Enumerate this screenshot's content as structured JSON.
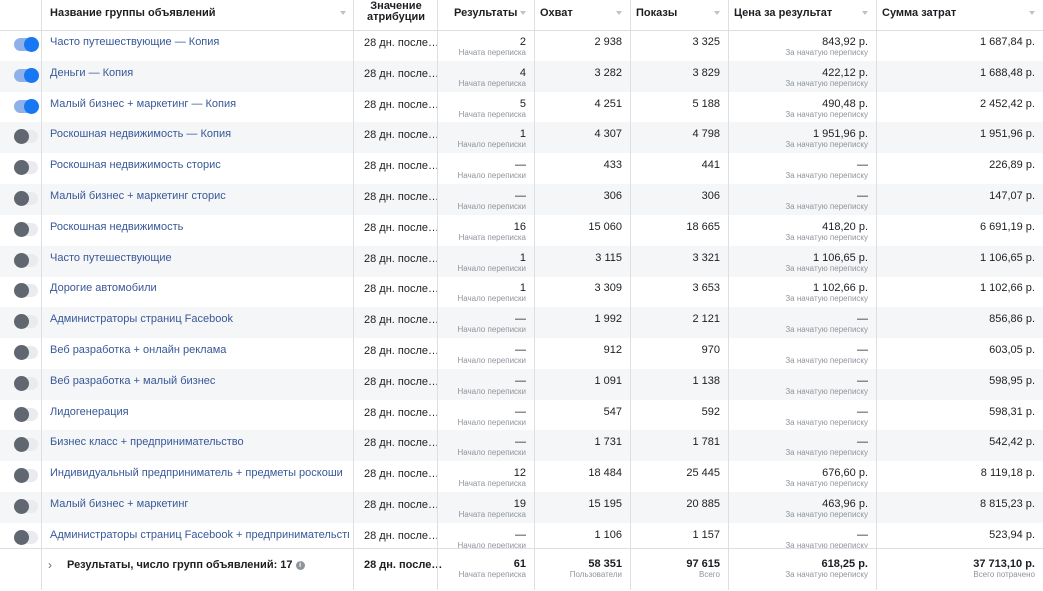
{
  "columns": {
    "name": "Название группы объявлений",
    "attribution_line1": "Значение",
    "attribution_line2": "атрибуции",
    "results": "Результаты",
    "reach": "Охват",
    "impressions": "Показы",
    "cost_per_result": "Цена за результат",
    "amount_spent": "Сумма затрат"
  },
  "rows": [
    {
      "on": true,
      "name": "Часто путешествующие — Копия",
      "attr": "28 дн. после…",
      "results": "2",
      "results_sub": "Начата переписка",
      "reach": "2 938",
      "impressions": "3 325",
      "cpr": "843,92 р.",
      "cpr_sub": "За начатую переписку",
      "spent": "1 687,84 р."
    },
    {
      "on": true,
      "name": "Деньги — Копия",
      "attr": "28 дн. после…",
      "results": "4",
      "results_sub": "Начата переписка",
      "reach": "3 282",
      "impressions": "3 829",
      "cpr": "422,12 р.",
      "cpr_sub": "За начатую переписку",
      "spent": "1 688,48 р."
    },
    {
      "on": true,
      "name": "Малый бизнес + маркетинг — Копия",
      "attr": "28 дн. после…",
      "results": "5",
      "results_sub": "Начата переписка",
      "reach": "4 251",
      "impressions": "5 188",
      "cpr": "490,48 р.",
      "cpr_sub": "За начатую переписку",
      "spent": "2 452,42 р."
    },
    {
      "on": false,
      "name": "Роскошная недвижимость — Копия",
      "attr": "28 дн. после…",
      "results": "1",
      "results_sub": "Начало переписки",
      "reach": "4 307",
      "impressions": "4 798",
      "cpr": "1 951,96 р.",
      "cpr_sub": "За начатую переписку",
      "spent": "1 951,96 р."
    },
    {
      "on": false,
      "name": "Роскошная недвижимость сторис",
      "attr": "28 дн. после…",
      "results": "—",
      "results_sub": "Начало переписки",
      "reach": "433",
      "impressions": "441",
      "cpr": "—",
      "cpr_sub": "За начатую переписку",
      "spent": "226,89 р."
    },
    {
      "on": false,
      "name": "Малый бизнес + маркетинг сторис",
      "attr": "28 дн. после…",
      "results": "—",
      "results_sub": "Начало переписки",
      "reach": "306",
      "impressions": "306",
      "cpr": "—",
      "cpr_sub": "За начатую переписку",
      "spent": "147,07 р."
    },
    {
      "on": false,
      "name": "Роскошная недвижимость",
      "attr": "28 дн. после…",
      "results": "16",
      "results_sub": "Начата переписка",
      "reach": "15 060",
      "impressions": "18 665",
      "cpr": "418,20 р.",
      "cpr_sub": "За начатую переписку",
      "spent": "6 691,19 р."
    },
    {
      "on": false,
      "name": "Часто путешествующие",
      "attr": "28 дн. после…",
      "results": "1",
      "results_sub": "Начало переписки",
      "reach": "3 115",
      "impressions": "3 321",
      "cpr": "1 106,65 р.",
      "cpr_sub": "За начатую переписку",
      "spent": "1 106,65 р."
    },
    {
      "on": false,
      "name": "Дорогие автомобили",
      "attr": "28 дн. после…",
      "results": "1",
      "results_sub": "Начало переписки",
      "reach": "3 309",
      "impressions": "3 653",
      "cpr": "1 102,66 р.",
      "cpr_sub": "За начатую переписку",
      "spent": "1 102,66 р."
    },
    {
      "on": false,
      "name": "Администраторы страниц Facebook",
      "attr": "28 дн. после…",
      "results": "—",
      "results_sub": "Начало переписки",
      "reach": "1 992",
      "impressions": "2 121",
      "cpr": "—",
      "cpr_sub": "За начатую переписку",
      "spent": "856,86 р."
    },
    {
      "on": false,
      "name": "Веб разработка + онлайн реклама",
      "attr": "28 дн. после…",
      "results": "—",
      "results_sub": "Начало переписки",
      "reach": "912",
      "impressions": "970",
      "cpr": "—",
      "cpr_sub": "За начатую переписку",
      "spent": "603,05 р."
    },
    {
      "on": false,
      "name": "Веб разработка + малый бизнес",
      "attr": "28 дн. после…",
      "results": "—",
      "results_sub": "Начало переписки",
      "reach": "1 091",
      "impressions": "1 138",
      "cpr": "—",
      "cpr_sub": "За начатую переписку",
      "spent": "598,95 р."
    },
    {
      "on": false,
      "name": "Лидогенерация",
      "attr": "28 дн. после…",
      "results": "—",
      "results_sub": "Начало переписки",
      "reach": "547",
      "impressions": "592",
      "cpr": "—",
      "cpr_sub": "За начатую переписку",
      "spent": "598,31 р."
    },
    {
      "on": false,
      "name": "Бизнес класс + предпринимательство",
      "attr": "28 дн. после…",
      "results": "—",
      "results_sub": "Начало переписки",
      "reach": "1 731",
      "impressions": "1 781",
      "cpr": "—",
      "cpr_sub": "За начатую переписку",
      "spent": "542,42 р."
    },
    {
      "on": false,
      "name": "Индивидуальный предприниматель + предметы роскоши",
      "attr": "28 дн. после…",
      "results": "12",
      "results_sub": "Начата переписка",
      "reach": "18 484",
      "impressions": "25 445",
      "cpr": "676,60 р.",
      "cpr_sub": "За начатую переписку",
      "spent": "8 119,18 р."
    },
    {
      "on": false,
      "name": "Малый бизнес + маркетинг",
      "attr": "28 дн. после…",
      "results": "19",
      "results_sub": "Начата переписка",
      "reach": "15 195",
      "impressions": "20 885",
      "cpr": "463,96 р.",
      "cpr_sub": "За начатую переписку",
      "spent": "8 815,23 р."
    },
    {
      "on": false,
      "name": "Администраторы страниц Facebook + предпринимательство",
      "attr": "28 дн. после…",
      "results": "—",
      "results_sub": "Начало переписки",
      "reach": "1 106",
      "impressions": "1 157",
      "cpr": "—",
      "cpr_sub": "За начатую переписку",
      "spent": "523,94 р."
    }
  ],
  "footer": {
    "label": "Результаты, число групп объявлений: 17",
    "info_glyph": "i",
    "attr": "28 дн. после…",
    "results": "61",
    "results_sub": "Начата переписка",
    "reach": "58 351",
    "reach_sub": "Пользователи",
    "impressions": "97 615",
    "impressions_sub": "Всего",
    "cpr": "618,25 р.",
    "cpr_sub": "За начатую переписку",
    "spent": "37 713,10 р.",
    "spent_sub": "Всего потрачено"
  }
}
